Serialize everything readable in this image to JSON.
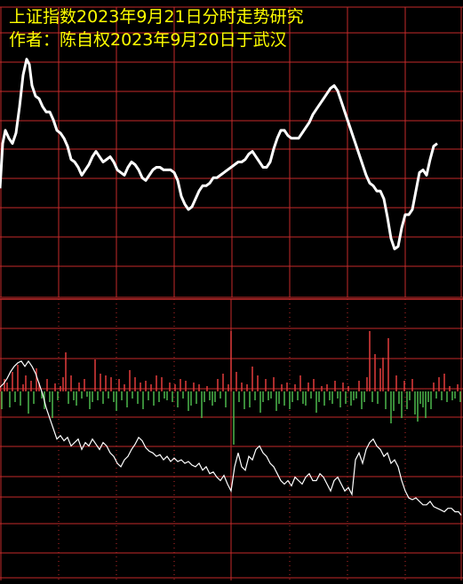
{
  "title_lines": [
    "上证指数2023年9月21日分时走势研究",
    "作者：陈自权2023年9月20日于武汉"
  ],
  "colors": {
    "background": "#000000",
    "grid": "#c42a2a",
    "title": "#ffff00",
    "line": "#ffffff",
    "volume_up": "#e23c3c",
    "volume_down": "#4cb84c",
    "panel_border": "#c42a2a"
  },
  "chart_data": [
    {
      "type": "line",
      "panel": "top",
      "title": "",
      "grid": true,
      "ylim": [
        0,
        100
      ],
      "x": [
        0,
        3,
        6,
        10,
        14,
        18,
        22,
        26,
        30,
        33,
        36,
        40,
        44,
        48,
        52,
        56,
        60,
        64,
        68,
        72,
        76,
        80,
        84,
        88,
        92,
        96,
        100,
        104,
        108,
        112,
        116,
        120,
        124,
        128,
        132,
        136,
        140,
        144,
        148,
        152,
        156,
        160,
        164,
        168,
        172,
        176,
        180,
        184,
        188,
        192,
        196,
        200,
        204,
        208,
        212,
        216,
        220,
        224,
        228,
        232,
        236,
        240,
        244,
        248,
        252,
        256,
        260,
        264,
        268,
        272,
        276,
        280,
        284,
        288,
        292,
        296,
        300,
        304,
        308,
        312,
        316,
        320,
        324,
        328,
        332,
        336,
        340,
        344,
        348,
        352,
        356,
        360,
        364,
        368,
        372,
        376,
        380,
        384,
        388,
        392,
        396,
        400,
        404,
        408,
        412,
        416,
        420,
        424,
        428,
        432,
        436,
        440,
        444,
        448,
        452,
        456,
        460,
        464,
        468,
        472,
        476,
        480,
        484,
        488,
        492,
        496,
        500,
        504,
        508,
        512,
        516,
        519
      ],
      "y": [
        41,
        58,
        63,
        60,
        58,
        62,
        72,
        84,
        90,
        88,
        80,
        76,
        75,
        72,
        70,
        70,
        67,
        63,
        62,
        60,
        57,
        52,
        51,
        49,
        46,
        48,
        50,
        53,
        55,
        53,
        51,
        52,
        53,
        51,
        48,
        47,
        46,
        49,
        51,
        50,
        48,
        45,
        44,
        46,
        48,
        49,
        49,
        48,
        48,
        48,
        47,
        44,
        38,
        35,
        33,
        34,
        37,
        40,
        42,
        42,
        43,
        45,
        45,
        46,
        47,
        48,
        49,
        50,
        51,
        51,
        52,
        54,
        55,
        53,
        51,
        49,
        49,
        51,
        56,
        60,
        63,
        63,
        61,
        60,
        60,
        60,
        62,
        64,
        66,
        69,
        71,
        73,
        75,
        77,
        79,
        80,
        78,
        74,
        70,
        66,
        62,
        58,
        54,
        50,
        46,
        43,
        42,
        40,
        40,
        37,
        30,
        22,
        18,
        19,
        26,
        31,
        31,
        33,
        40,
        47,
        48,
        46,
        52,
        57,
        58
      ],
      "line_color": "#ffffff"
    },
    {
      "type": "bar",
      "panel": "volume",
      "title": "",
      "grid": false,
      "ylim": [
        -60,
        40
      ],
      "x": [
        2,
        5,
        8,
        11,
        14,
        17,
        20,
        23,
        26,
        29,
        32,
        35,
        38,
        41,
        44,
        47,
        50,
        53,
        56,
        59,
        62,
        65,
        68,
        71,
        74,
        77,
        80,
        83,
        86,
        89,
        92,
        95,
        98,
        101,
        104,
        107,
        110,
        113,
        116,
        119,
        122,
        125,
        128,
        131,
        134,
        137,
        140,
        143,
        146,
        149,
        152,
        155,
        158,
        161,
        164,
        167,
        170,
        173,
        176,
        179,
        182,
        185,
        188,
        191,
        194,
        197,
        200,
        203,
        206,
        209,
        212,
        215,
        218,
        221,
        224,
        227,
        230,
        233,
        236,
        239,
        242,
        245,
        248,
        251,
        254,
        257,
        260,
        263,
        266,
        269,
        272,
        275,
        278,
        281,
        284,
        287,
        290,
        293,
        296,
        299,
        302,
        305,
        308,
        311,
        314,
        317,
        320,
        323,
        326,
        329,
        332,
        335,
        338,
        341,
        344,
        347,
        350,
        353,
        356,
        359,
        362,
        365,
        368,
        371,
        374,
        377,
        380,
        383,
        386,
        389,
        392,
        395,
        398,
        401,
        404,
        407,
        410,
        413,
        416,
        419,
        422,
        425,
        428,
        431,
        434,
        437,
        440,
        443,
        446,
        449,
        452,
        455,
        458,
        461,
        464,
        467,
        470,
        473,
        476,
        479,
        482,
        485,
        488,
        491,
        494,
        497,
        500,
        503,
        506,
        509,
        512,
        515,
        518
      ],
      "values": [
        -20,
        14,
        10,
        -18,
        22,
        -12,
        30,
        -16,
        8,
        18,
        -25,
        12,
        -14,
        26,
        10,
        -8,
        -20,
        14,
        -12,
        -30,
        9,
        -10,
        6,
        16,
        44,
        -14,
        18,
        -10,
        -16,
        10,
        -8,
        14,
        -6,
        -20,
        -12,
        36,
        -10,
        20,
        -14,
        18,
        -8,
        16,
        -12,
        -22,
        14,
        -10,
        8,
        -18,
        24,
        -8,
        16,
        -14,
        10,
        -20,
        12,
        -10,
        8,
        -16,
        18,
        -12,
        16,
        -8,
        -10,
        10,
        -12,
        8,
        -18,
        14,
        -8,
        12,
        -22,
        -16,
        10,
        -14,
        8,
        -30,
        -12,
        6,
        -10,
        -16,
        -12,
        14,
        -8,
        20,
        -18,
        8,
        68,
        -60,
        22,
        -12,
        10,
        -20,
        8,
        -18,
        28,
        -10,
        18,
        -24,
        -12,
        14,
        -10,
        -8,
        16,
        -22,
        -14,
        8,
        -16,
        10,
        -20,
        -12,
        8,
        -10,
        18,
        -14,
        -16,
        10,
        -8,
        14,
        -24,
        -12,
        6,
        -16,
        8,
        -10,
        -14,
        12,
        -8,
        -18,
        10,
        -14,
        6,
        -16,
        -10,
        -8,
        12,
        -20,
        -12,
        16,
        68,
        -12,
        42,
        -14,
        26,
        38,
        -20,
        60,
        -36,
        -22,
        18,
        -14,
        -30,
        12,
        -20,
        -10,
        14,
        -26,
        -34,
        -14,
        -18,
        -30,
        -12,
        -20,
        10,
        -8,
        16,
        -10,
        20,
        -12,
        6,
        -10,
        -8,
        8,
        -12,
        4,
        6
      ]
    },
    {
      "type": "line",
      "panel": "bottom",
      "title": "",
      "grid": true,
      "ylim": [
        0,
        100
      ],
      "x": [
        0,
        4,
        8,
        12,
        16,
        20,
        24,
        28,
        32,
        36,
        40,
        44,
        48,
        52,
        56,
        60,
        64,
        68,
        72,
        76,
        80,
        84,
        88,
        92,
        96,
        100,
        104,
        108,
        112,
        116,
        120,
        124,
        128,
        132,
        136,
        140,
        144,
        148,
        152,
        156,
        160,
        164,
        168,
        172,
        176,
        180,
        184,
        188,
        192,
        196,
        200,
        204,
        208,
        212,
        216,
        220,
        224,
        228,
        232,
        236,
        240,
        244,
        248,
        252,
        256,
        260,
        264,
        268,
        272,
        276,
        280,
        284,
        288,
        292,
        296,
        300,
        304,
        308,
        312,
        316,
        320,
        324,
        328,
        332,
        336,
        340,
        344,
        348,
        352,
        356,
        360,
        364,
        368,
        372,
        376,
        380,
        384,
        388,
        392,
        396,
        400,
        404,
        408,
        412,
        416,
        420,
        424,
        428,
        432,
        436,
        440,
        444,
        448,
        452,
        456,
        460,
        464,
        468,
        472,
        476,
        480,
        484,
        488,
        492,
        496,
        500,
        504,
        508,
        512,
        516,
        519
      ],
      "y": [
        84,
        86,
        89,
        93,
        96,
        98,
        99,
        96,
        99,
        96,
        92,
        86,
        80,
        72,
        66,
        60,
        54,
        56,
        53,
        55,
        50,
        52,
        54,
        48,
        52,
        50,
        54,
        51,
        48,
        52,
        50,
        46,
        44,
        40,
        38,
        42,
        44,
        48,
        51,
        55,
        53,
        49,
        47,
        46,
        44,
        45,
        42,
        44,
        41,
        43,
        41,
        42,
        40,
        41,
        39,
        38,
        40,
        36,
        38,
        34,
        35,
        32,
        30,
        33,
        28,
        24,
        38,
        46,
        38,
        36,
        44,
        42,
        48,
        50,
        46,
        44,
        40,
        38,
        34,
        30,
        28,
        30,
        27,
        32,
        30,
        28,
        32,
        34,
        30,
        30,
        34,
        32,
        28,
        24,
        30,
        32,
        28,
        24,
        26,
        22,
        42,
        46,
        40,
        48,
        52,
        54,
        50,
        48,
        44,
        46,
        40,
        42,
        38,
        30,
        24,
        20,
        19,
        20,
        18,
        16,
        16,
        18,
        15,
        14,
        13,
        12,
        14,
        14,
        12,
        12,
        10
      ],
      "line_color": "#ffffff"
    }
  ]
}
